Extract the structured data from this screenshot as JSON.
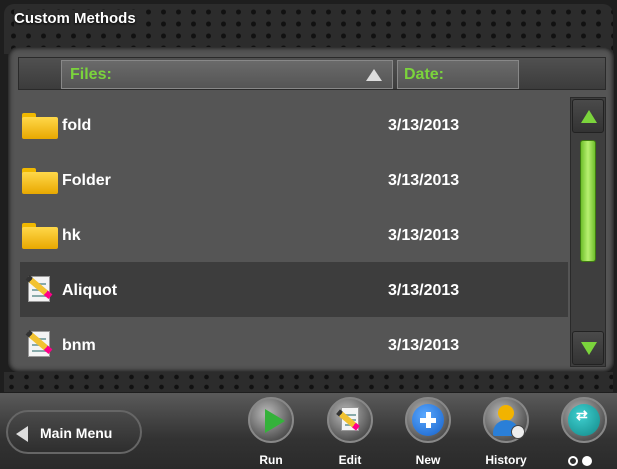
{
  "title": "Custom Methods",
  "header": {
    "files_label": "Files:",
    "date_label": "Date:"
  },
  "rows": [
    {
      "type": "folder",
      "name": "fold",
      "date": "3/13/2013",
      "selected": false
    },
    {
      "type": "folder",
      "name": "Folder",
      "date": "3/13/2013",
      "selected": false
    },
    {
      "type": "folder",
      "name": "hk",
      "date": "3/13/2013",
      "selected": false
    },
    {
      "type": "method",
      "name": "Aliquot",
      "date": "3/13/2013",
      "selected": true
    },
    {
      "type": "method",
      "name": "bnm",
      "date": "3/13/2013",
      "selected": false
    }
  ],
  "toolbar": {
    "main_menu": "Main Menu",
    "run": "Run",
    "edit": "Edit",
    "new": "New",
    "history": "History"
  },
  "pagination": {
    "current": 2,
    "total": 2
  },
  "colors": {
    "accent": "#7bd43c",
    "panel": "#555555",
    "selected_row": "#3d3d3d"
  },
  "icons": [
    "folder-icon",
    "document-pencil-icon",
    "sort-up-icon",
    "scroll-up-icon",
    "scroll-down-icon",
    "back-arrow-icon",
    "play-icon",
    "edit-icon",
    "plus-icon",
    "history-icon",
    "swap-icon"
  ]
}
